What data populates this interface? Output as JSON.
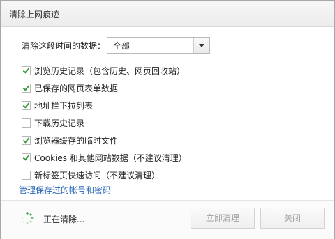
{
  "window": {
    "title": "清除上网痕迹"
  },
  "range": {
    "label": "清除这段时间的数据：",
    "selected": "全部"
  },
  "options": [
    {
      "label": "浏览历史记录（包含历史、网页回收站）",
      "checked": true
    },
    {
      "label": "已保存的网页表单数据",
      "checked": true
    },
    {
      "label": "地址栏下拉列表",
      "checked": true
    },
    {
      "label": "下载历史记录",
      "checked": false
    },
    {
      "label": "浏览器缓存的临时文件",
      "checked": true
    },
    {
      "label": "Cookies 和其他网站数据（不建议清理）",
      "checked": true
    },
    {
      "label": "新标签页快速访问（不建议清理）",
      "checked": false
    }
  ],
  "manage_link": "管理保存过的帐号和密码",
  "footer": {
    "status": "正在清除...",
    "clear_button": "立即清理",
    "close_button": "关闭"
  },
  "colors": {
    "check": "#3b9a3b",
    "link": "#2a67b8"
  }
}
